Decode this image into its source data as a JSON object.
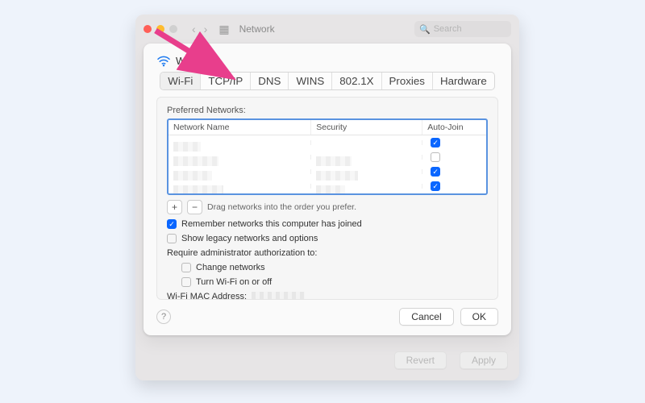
{
  "window": {
    "title": "Network",
    "search_placeholder": "Search"
  },
  "header": {
    "interface_title": "Wi-Fi"
  },
  "tabs": {
    "items": [
      "Wi-Fi",
      "TCP/IP",
      "DNS",
      "WINS",
      "802.1X",
      "Proxies",
      "Hardware"
    ],
    "active": "Wi-Fi"
  },
  "preferred": {
    "label": "Preferred Networks:",
    "cols": {
      "name": "Network Name",
      "security": "Security",
      "autojoin": "Auto-Join"
    },
    "rows": [
      {
        "name_blur_w": 34,
        "sec_blur_w": 0,
        "autojoin": true
      },
      {
        "name_blur_w": 56,
        "sec_blur_w": 44,
        "autojoin": false
      },
      {
        "name_blur_w": 48,
        "sec_blur_w": 52,
        "autojoin": true
      },
      {
        "name_blur_w": 62,
        "sec_blur_w": 36,
        "autojoin": true
      }
    ],
    "drag_hint": "Drag networks into the order you prefer."
  },
  "options": {
    "remember": {
      "label": "Remember networks this computer has joined",
      "checked": true
    },
    "legacy": {
      "label": "Show legacy networks and options",
      "checked": false
    },
    "require_label": "Require administrator authorization to:",
    "change_networks": {
      "label": "Change networks",
      "checked": false
    },
    "toggle_wifi": {
      "label": "Turn Wi-Fi on or off",
      "checked": false
    }
  },
  "mac": {
    "label": "Wi-Fi MAC Address:"
  },
  "buttons": {
    "cancel": "Cancel",
    "ok": "OK",
    "revert": "Revert",
    "apply": "Apply"
  },
  "annotation": {
    "points_to": "tab-tcpip",
    "color": "#e83e8c"
  }
}
